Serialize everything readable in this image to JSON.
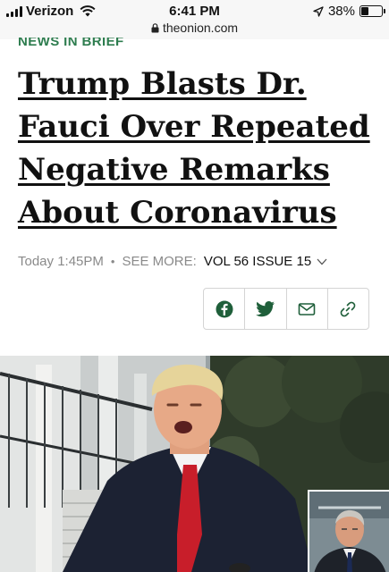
{
  "status_bar": {
    "carrier": "Verizon",
    "time": "6:41 PM",
    "url": "theonion.com",
    "battery": "38%",
    "battery_level": 0.38,
    "icons": [
      "signal-bars-icon",
      "wifi-icon",
      "lock-icon",
      "location-arrow-icon",
      "battery-icon"
    ]
  },
  "article": {
    "section": "NEWS IN BRIEF",
    "headline": "Trump Blasts Dr. Fauci Over Repeated Negative Remarks About Coronavirus",
    "timestamp": "Today 1:45PM",
    "separator": "•",
    "see_more_label": "SEE MORE:",
    "issue": "VOL 56 ISSUE 15"
  },
  "share": {
    "buttons": [
      "facebook-icon",
      "twitter-icon",
      "email-icon",
      "link-icon"
    ],
    "icon_color": "#1f5f3a"
  },
  "colors": {
    "section_label": "#2e7d4f",
    "meta_text": "#8a8a8a",
    "accent_green": "#1f5f3a"
  }
}
